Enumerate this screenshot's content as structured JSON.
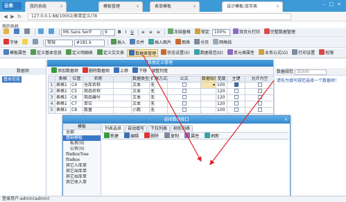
{
  "browser": {
    "app_name": "云表",
    "tabs": [
      {
        "label": "我的系统",
        "active": false
      },
      {
        "label": "模板管理",
        "active": false
      },
      {
        "label": "表单模板",
        "active": false
      },
      {
        "label": "设计模板:库存表",
        "active": true
      }
    ],
    "url": "127.0.0.1:88/10002/表单定义/78",
    "bookmark": "我的系统"
  },
  "toolbar1": {
    "font_name": "MS Sans Serif",
    "font_size": "9",
    "freeze_label": "冻结窗格",
    "lock_label": "锁定",
    "zoom": "100%",
    "repeat_header_label": "双页头打印",
    "page_break_label": "分页",
    "show_grid_label": "网格线",
    "complete_label": "完整数据管理"
  },
  "toolbar2": {
    "font_color_label": "字体",
    "format_label": "常规",
    "value": "#181.k",
    "preset_label": "插入",
    "merge_label": "合并",
    "img_label": "插入图片",
    "chart_label": "图表"
  },
  "toolbar3": {
    "items": [
      "模板属性",
      "定义基本信息",
      "定义明细表",
      "定义交叉表",
      "数据表管理",
      "状态设置(S)",
      "数据规范(D)",
      "单元格属性",
      "业务公式(G)",
      "打印设置",
      "权限"
    ]
  },
  "left_panel": {
    "title": "数据项",
    "root_item": "基本信息"
  },
  "center_panel": {
    "title": "数据定义管理",
    "toolbar": {
      "add_label": "添加数据项",
      "delete_label": "删除数据项",
      "up_label": "上移",
      "down_label": "下移",
      "adjust_label": "调整列宽"
    },
    "columns": [
      "表格",
      "位置",
      "名称",
      "数据类型",
      "扩展方式",
      "公式",
      "数据规范",
      "宽度",
      "主键",
      "允许为空"
    ],
    "rows": [
      {
        "num": "1",
        "table": "表格1",
        "pos": "C4",
        "name": "仓库名称",
        "type": "文本",
        "extend": "无",
        "width": "100",
        "key": true
      },
      {
        "num": "2",
        "table": "表格1",
        "pos": "C5",
        "name": "商品名称",
        "type": "文本",
        "extend": "无",
        "width": "120",
        "key": false
      },
      {
        "num": "3",
        "table": "表格1",
        "pos": "C6",
        "name": "商品编号",
        "type": "文本",
        "extend": "无",
        "width": "120",
        "key": false
      },
      {
        "num": "4",
        "table": "表格1",
        "pos": "C7",
        "name": "单位",
        "type": "文本",
        "extend": "无",
        "width": "120",
        "key": false
      },
      {
        "num": "5",
        "table": "表格1",
        "pos": "C8",
        "name": "数量",
        "type": "小数",
        "extend": "无",
        "width": "100",
        "key": false
      }
    ]
  },
  "right_panel": {
    "title": "数据规范",
    "search_placeholder": "请选择",
    "hint": "请先为填写规范选择一个数据项！"
  },
  "dialog": {
    "title": "选择数据接口",
    "left_title": "模板",
    "tree": [
      "全部",
      "基础模板",
      "私有(0)",
      "公有(0)",
      "fileBoxTree",
      "fileBox",
      "其它入库单",
      "其它出库单",
      "其它出库单",
      "其它收入单"
    ],
    "tabs": [
      {
        "label": "列表选择",
        "active": true
      },
      {
        "label": "自动填写",
        "active": false
      },
      {
        "label": "下拉列表",
        "active": false
      },
      {
        "label": "树形列表",
        "active": false
      }
    ],
    "tools": [
      "新建",
      "编辑",
      "删除",
      "复制",
      "属性",
      "刷新"
    ]
  },
  "status": {
    "text": "登录用户:admin(admin)"
  },
  "colors": {
    "accent": "#3d9ad6",
    "selection": "#3b78c8",
    "arrow": "#e0222a",
    "highlight": "#f6e3a8"
  }
}
